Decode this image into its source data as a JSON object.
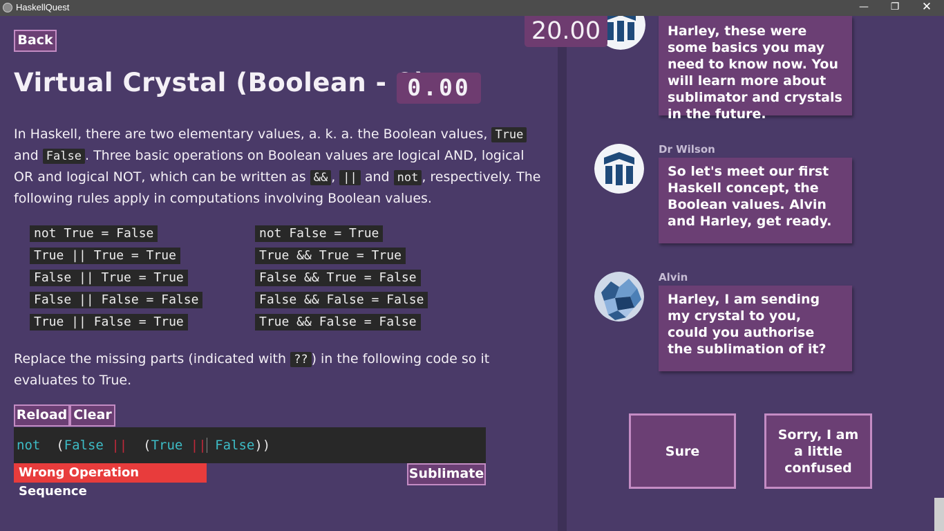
{
  "window": {
    "title": "HaskellQuest",
    "minimize": "—",
    "maximize": "❐",
    "close": "✕"
  },
  "lesson": {
    "back_label": "Back",
    "title": "Virtual Crystal (Boolean - 0)",
    "score": "0.00",
    "timer": "20.00",
    "intro": {
      "t1": "In Haskell, there are two elementary values, a. k. a. the Boolean values, ",
      "c1": "True",
      "t2": " and ",
      "c2": "False",
      "t3": ". Three basic operations on Boolean values are logical AND, logical OR and logical NOT, which can be written as ",
      "c3": "&&",
      "t4": ", ",
      "c4": "||",
      "t5": " and ",
      "c5": "not",
      "t6": ", respectively. The following rules apply in computations involving Boolean values."
    },
    "rules_left": [
      "not True = False",
      "True || True = True",
      "False || True = True",
      "False || False = False",
      "True || False = True"
    ],
    "rules_right": [
      "not False = True",
      "True && True = True",
      "False && True = False",
      "False && False = False",
      "True && False = False"
    ],
    "instruction": {
      "t1": "Replace the missing parts (indicated with ",
      "c1": "??",
      "t2": ") in the following code so it evaluates to True."
    },
    "reload_label": "Reload",
    "clear_label": "Clear",
    "code": {
      "tok1": "not",
      "tok2": "(",
      "tok3": "False",
      "tok4": "||",
      "tok5": "(",
      "tok6": "True",
      "tok7": "||",
      "tok8": "False",
      "tok9": "))"
    },
    "error_message": "Wrong Operation Sequence",
    "sublimate_label": "Sublimate"
  },
  "chat": {
    "messages": [
      {
        "speaker": "",
        "avatar_icon": "robot-avatar-icon",
        "text": "Harley, these were some basics you may need to know now. You will learn more about sublimator and crystals in the future."
      },
      {
        "speaker": "Dr Wilson",
        "avatar_icon": "robot-avatar-icon",
        "text": "So let's meet our first Haskell concept, the Boolean values. Alvin and Harley, get ready."
      },
      {
        "speaker": "Alvin",
        "avatar_icon": "crystal-avatar-icon",
        "text": "Harley, I am sending my crystal to you, could you authorise the sublimation of it?"
      }
    ],
    "choices": [
      "Sure",
      "Sorry, I am a little confused"
    ]
  },
  "colors": {
    "background": "#4a3a68",
    "accent": "#6b3f74",
    "border": "#c48cc4",
    "error": "#e83c3c",
    "code_keyword": "#3dbcc6",
    "code_operator": "#c0283a"
  }
}
